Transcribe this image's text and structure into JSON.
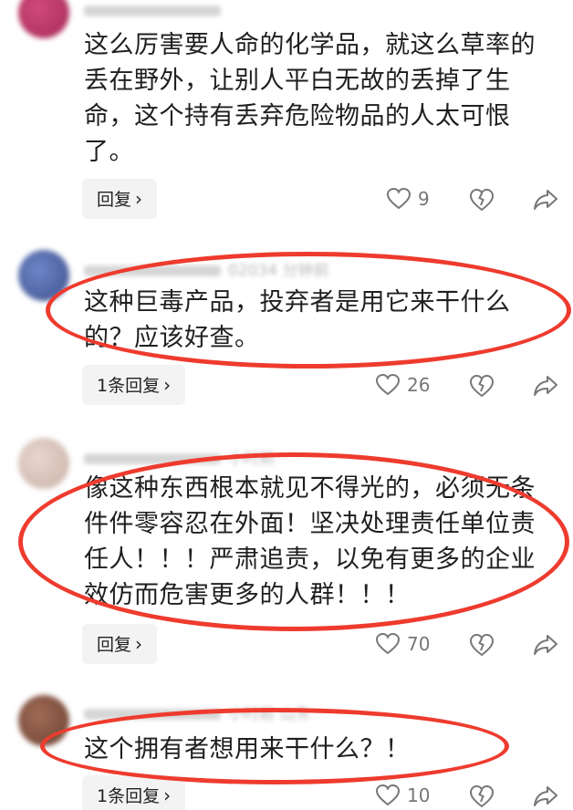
{
  "comments": [
    {
      "meta": "",
      "text": "这么厉害要人命的化学品，就这么草率的丢在野外，让别人平白无故的丢掉了生命，这个持有丢弃危险物品的人太可恨了。",
      "reply_label": "回复",
      "likes": "9",
      "avatar_color": "#c43a6a"
    },
    {
      "meta": "02034  分钟前  陕西",
      "text": "这种巨毒产品，投弃者是用它来干什么的？应该好查。",
      "reply_label": "1条回复",
      "likes": "26",
      "avatar_color": "#5a6fb0"
    },
    {
      "meta": "小时前",
      "text": "像这种东西根本就见不得光的，必须无条件件零容忍在外面！坚决处理责任单位责任人！！！严肃追责，以免有更多的企业效仿而危害更多的人群！！！",
      "reply_label": "回复",
      "likes": "70",
      "avatar_color": "#d8c4bb"
    },
    {
      "meta": "小时前  山东",
      "text": "这个拥有者想用来干什么？！",
      "reply_label": "1条回复",
      "likes": "10",
      "avatar_color": "#8a5a48"
    }
  ],
  "colors": {
    "highlight_oval": "#ee3b2e",
    "reply_bg": "#f3f3f3",
    "icon": "#777777"
  },
  "icons": [
    "heart-icon",
    "broken-heart-icon",
    "share-icon",
    "chevron-right-icon"
  ]
}
